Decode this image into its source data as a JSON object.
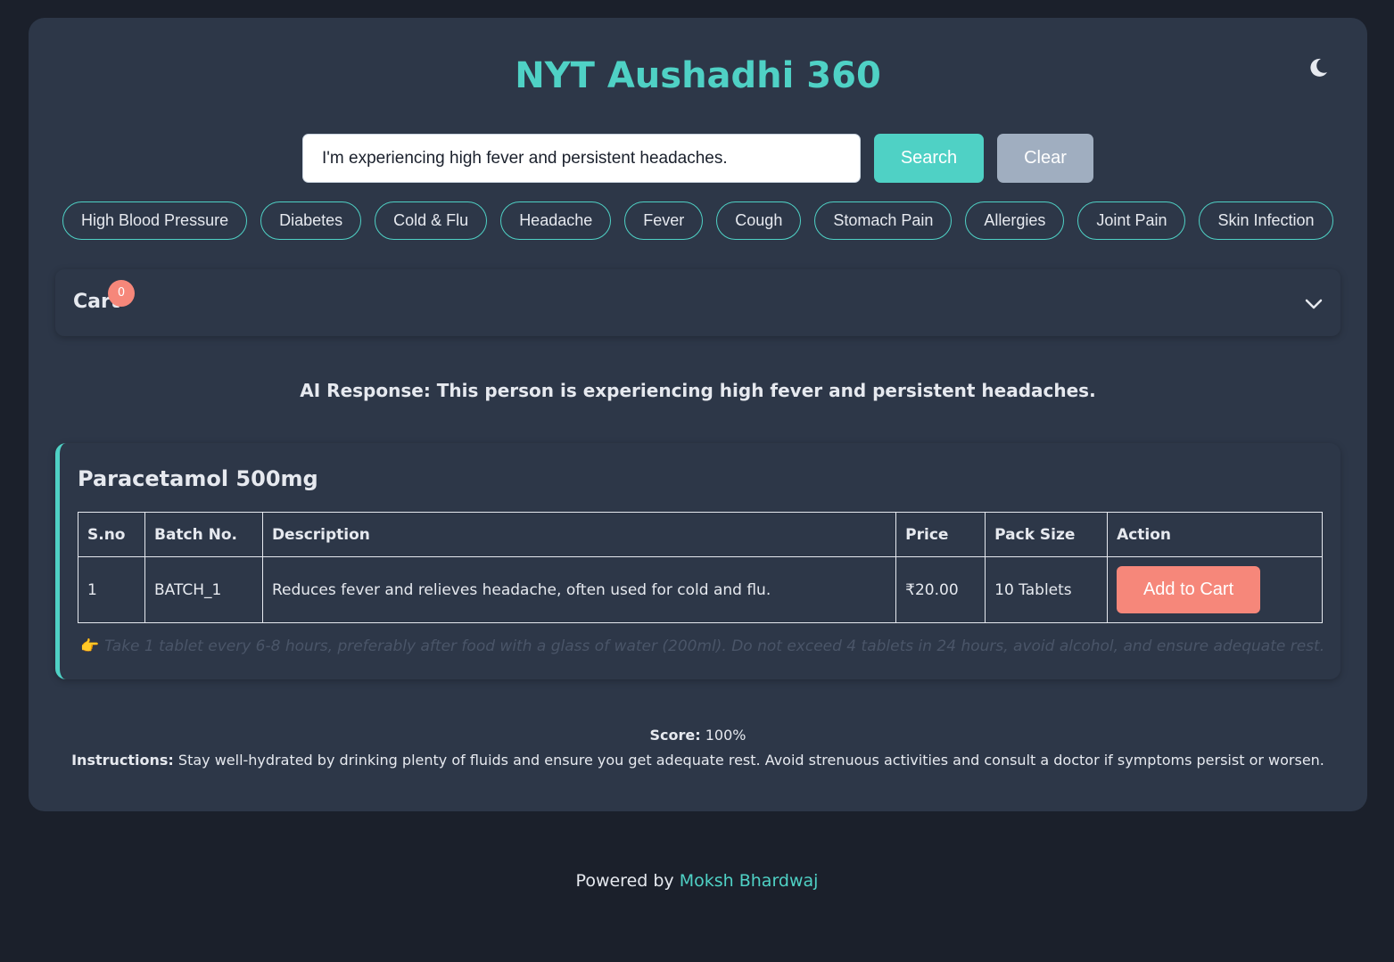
{
  "header": {
    "title": "NYT Aushadhi 360",
    "theme_icon": "moon-icon"
  },
  "search": {
    "value": "I'm experiencing high fever and persistent headaches.",
    "search_label": "Search",
    "clear_label": "Clear"
  },
  "chips": [
    "High Blood Pressure",
    "Diabetes",
    "Cold & Flu",
    "Headache",
    "Fever",
    "Cough",
    "Stomach Pain",
    "Allergies",
    "Joint Pain",
    "Skin Infection"
  ],
  "cart": {
    "label": "Cart",
    "count": "0"
  },
  "ai_response": {
    "label": "AI Response:",
    "text": "This person is experiencing high fever and persistent headaches."
  },
  "medicine": {
    "name": "Paracetamol 500mg",
    "headers": [
      "S.no",
      "Batch No.",
      "Description",
      "Price",
      "Pack Size",
      "Action"
    ],
    "row": {
      "sno": "1",
      "batch": "BATCH_1",
      "description": "Reduces fever and relieves headache, often used for cold and flu.",
      "price": "₹20.00",
      "pack_size": "10 Tablets",
      "action_label": "Add to Cart"
    },
    "note": "Take 1 tablet every 6-8 hours, preferably after food with a glass of water (200ml). Do not exceed 4 tablets in 24 hours, avoid alcohol, and ensure adequate rest."
  },
  "summary": {
    "score_label": "Score:",
    "score_value": "100%",
    "instructions_label": "Instructions:",
    "instructions_text": "Stay well-hydrated by drinking plenty of fluids and ensure you get adequate rest. Avoid strenuous activities and consult a doctor if symptoms persist or worsen."
  },
  "footer": {
    "prefix": "Powered by",
    "author": "Moksh Bhardwaj"
  },
  "colors": {
    "accent": "#4fd1c5",
    "danger": "#f6877a",
    "panel": "#2d3748",
    "background": "#1b202b"
  }
}
